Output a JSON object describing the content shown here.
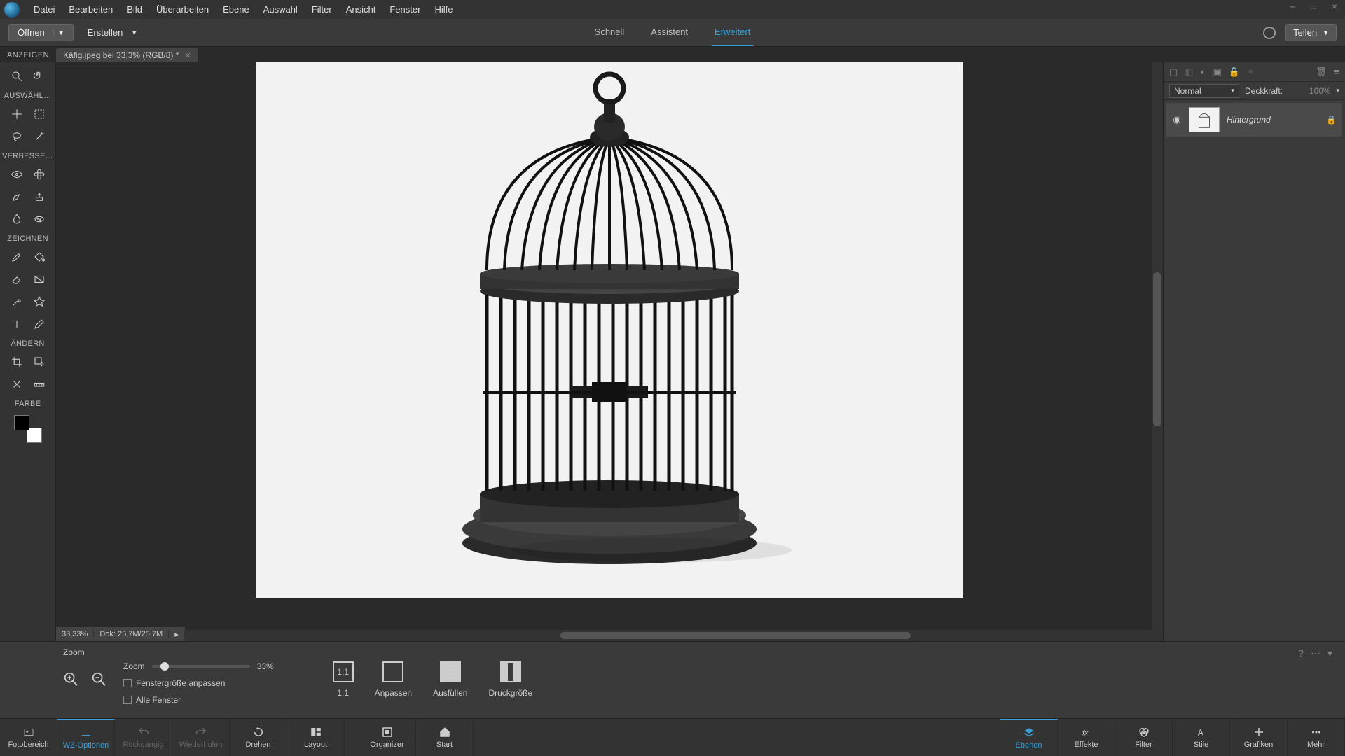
{
  "menu": [
    "Datei",
    "Bearbeiten",
    "Bild",
    "Überarbeiten",
    "Ebene",
    "Auswahl",
    "Filter",
    "Ansicht",
    "Fenster",
    "Hilfe"
  ],
  "secbar": {
    "open": "Öffnen",
    "create": "Erstellen",
    "share": "Teilen"
  },
  "modes": {
    "quick": "Schnell",
    "guided": "Assistent",
    "expert": "Erweitert"
  },
  "doc_tab": "Käfig.jpeg bei 33,3% (RGB/8) *",
  "tool_sections": {
    "view": "ANZEIGEN",
    "select": "AUSWÄHL…",
    "enhance": "VERBESSE…",
    "draw": "ZEICHNEN",
    "modify": "ÄNDERN",
    "color": "FARBE"
  },
  "status": {
    "zoom": "33,33%",
    "doc": "Dok: 25,7M/25,7M"
  },
  "layers": {
    "blend_mode": "Normal",
    "opacity_label": "Deckkraft:",
    "opacity_val": "100%",
    "layer0": "Hintergrund"
  },
  "options": {
    "title": "Zoom",
    "zoom_label": "Zoom",
    "zoom_pct": "33%",
    "fit_window": "Fenstergröße anpassen",
    "all_windows": "Alle Fenster",
    "one_to_one": "1:1",
    "fit": "Anpassen",
    "fill": "Ausfüllen",
    "print": "Druckgröße"
  },
  "bottom_left": {
    "photo_bin": "Fotobereich",
    "tool_opts": "WZ-Optionen",
    "undo": "Rückgängig",
    "redo": "Wiederholen",
    "rotate": "Drehen",
    "layout": "Layout",
    "organizer": "Organizer",
    "home": "Start"
  },
  "bottom_right": {
    "layers": "Ebenen",
    "effects": "Effekte",
    "filters": "Filter",
    "styles": "Stile",
    "graphics": "Grafiken",
    "more": "Mehr"
  }
}
